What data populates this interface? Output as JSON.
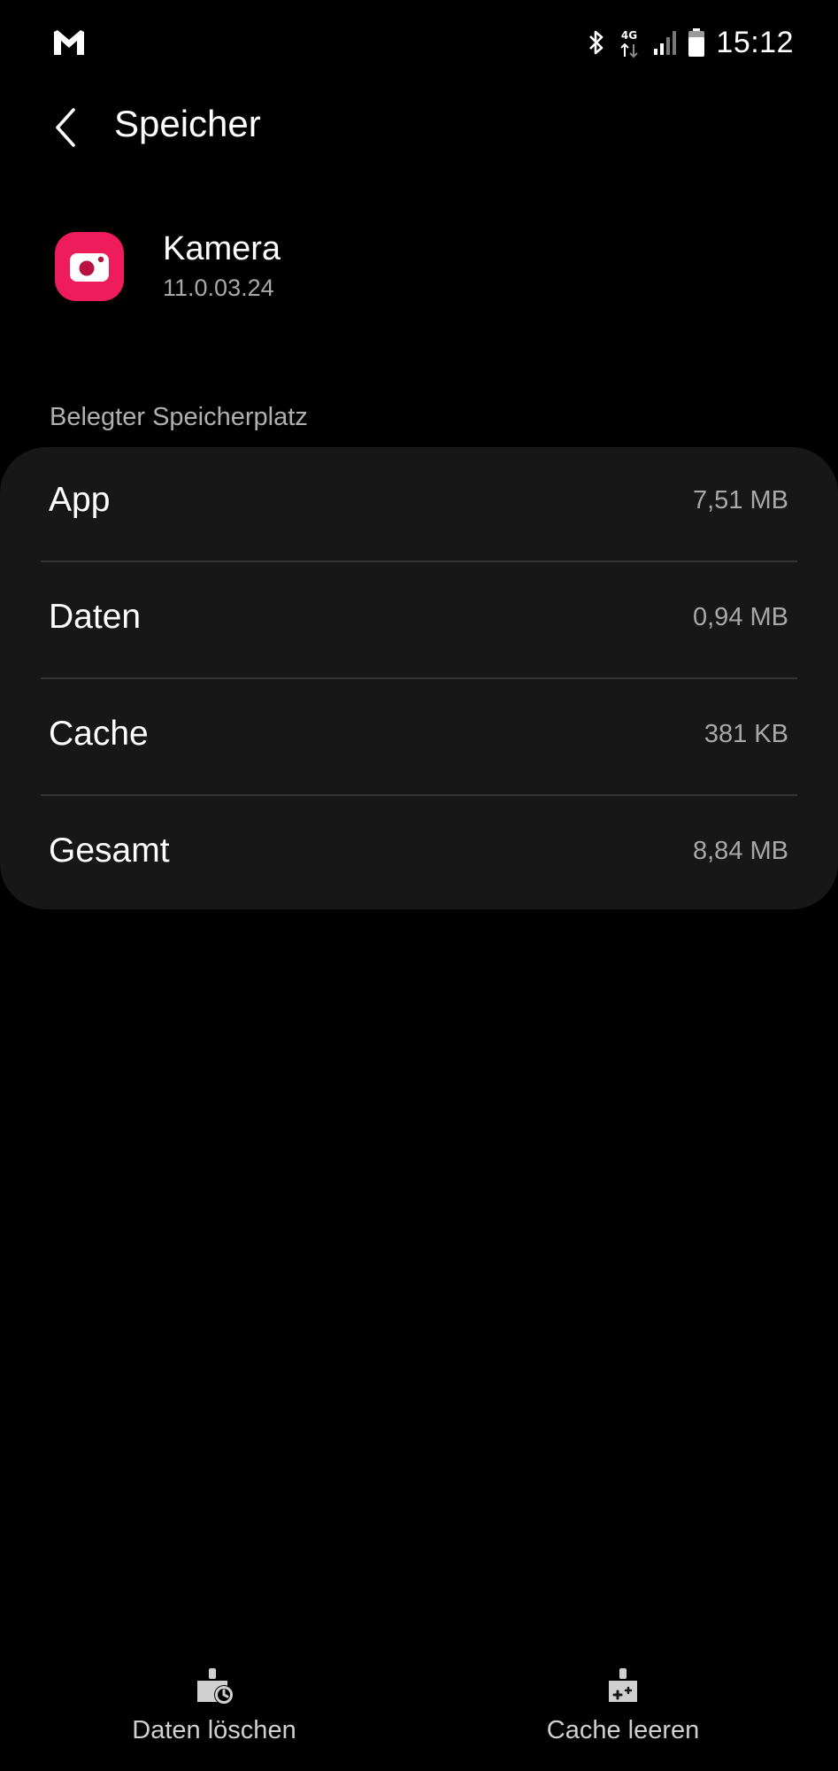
{
  "status_bar": {
    "time": "15:12",
    "network_label": "4G",
    "icons": [
      "gmail-icon",
      "bluetooth-icon",
      "mobile-data-4g-icon",
      "signal-icon",
      "battery-icon"
    ]
  },
  "topbar": {
    "title": "Speicher",
    "back_icon": "chevron-left-icon"
  },
  "app": {
    "name": "Kamera",
    "version": "11.0.03.24",
    "icon": "camera-icon",
    "icon_color": "#ee1c5a"
  },
  "storage": {
    "section_label": "Belegter Speicherplatz",
    "rows": [
      {
        "label": "App",
        "value": "7,51 MB"
      },
      {
        "label": "Daten",
        "value": "0,94 MB"
      },
      {
        "label": "Cache",
        "value": "381 KB"
      },
      {
        "label": "Gesamt",
        "value": "8,84 MB"
      }
    ]
  },
  "actions": {
    "clear_data": {
      "label": "Daten löschen",
      "icon": "clear-data-broom-icon"
    },
    "clear_cache": {
      "label": "Cache leeren",
      "icon": "clear-cache-broom-icon"
    }
  },
  "colors": {
    "background": "#000000",
    "card": "#171717",
    "divider": "#333333",
    "secondary_text": "#a8a8a8"
  }
}
